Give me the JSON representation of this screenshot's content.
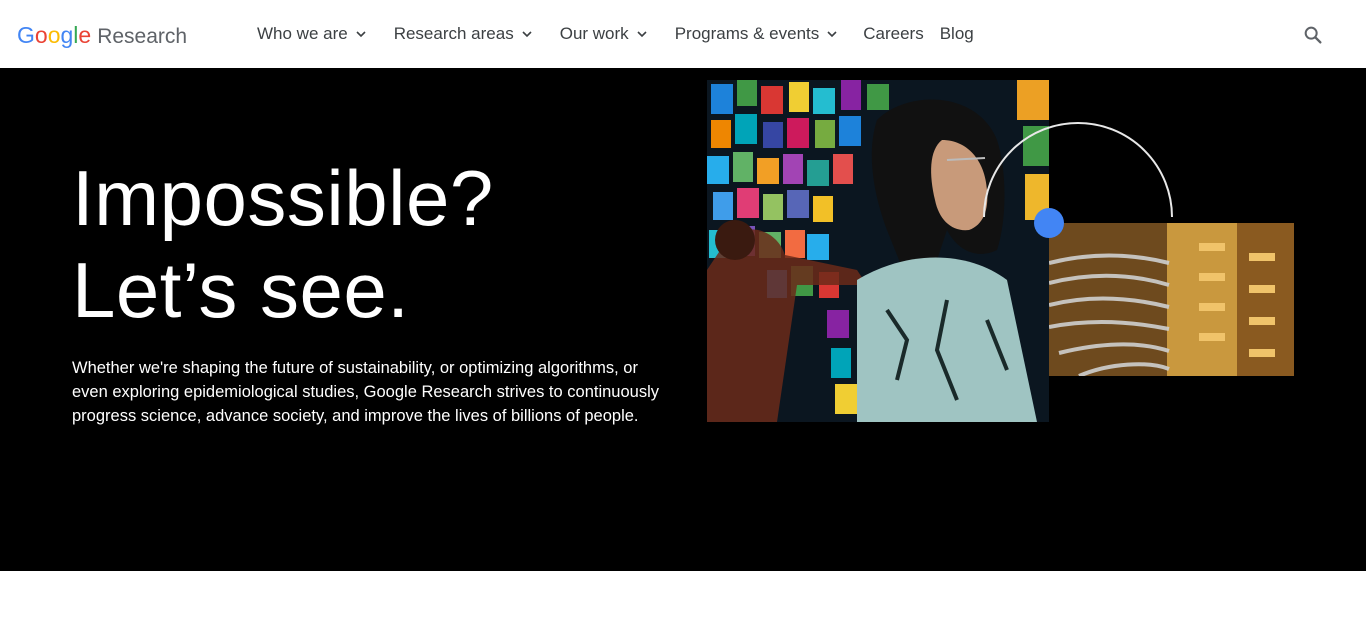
{
  "header": {
    "logo": {
      "google": [
        "G",
        "o",
        "o",
        "g",
        "l",
        "e"
      ],
      "product": "Research"
    },
    "nav": [
      {
        "label": "Who we are",
        "has_dropdown": true
      },
      {
        "label": "Research areas",
        "has_dropdown": true
      },
      {
        "label": "Our work",
        "has_dropdown": true
      },
      {
        "label": "Programs & events",
        "has_dropdown": true
      },
      {
        "label": "Careers",
        "has_dropdown": false
      },
      {
        "label": "Blog",
        "has_dropdown": false
      }
    ],
    "search_icon": "search-icon"
  },
  "hero": {
    "headline_line1": "Impossible?",
    "headline_line2": "Let’s see.",
    "description": "Whether we're shaping the future of sustainability, or optimizing algorithms, or even exploring epidemiological studies, Google Research strives to continuously progress science, advance society, and improve the lives of billions of people."
  },
  "colors": {
    "google_blue": "#4285F4",
    "google_red": "#EA4335",
    "google_yellow": "#FBBC05",
    "google_green": "#34A853",
    "hero_bg": "#000000",
    "accent_dot": "#4285F4"
  }
}
